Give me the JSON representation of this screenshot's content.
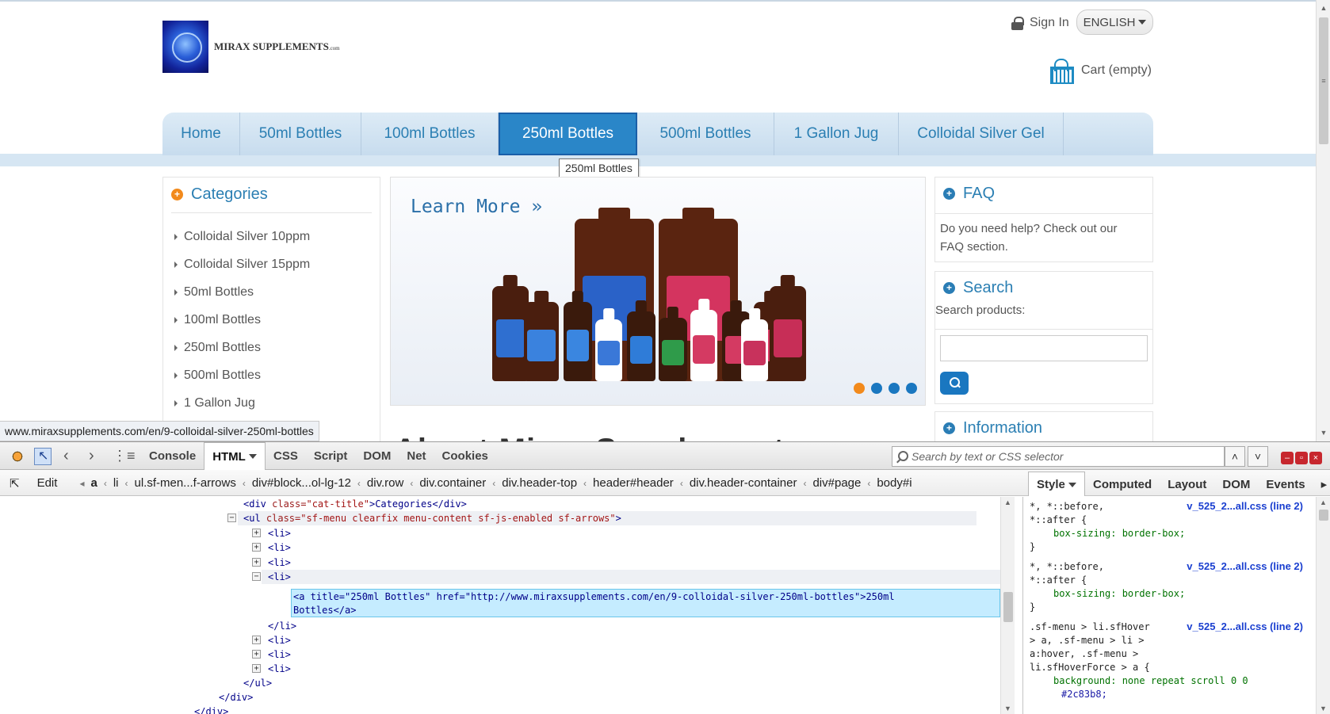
{
  "site": {
    "logo_text": "MIRAX SUPPLEMENTS",
    "logo_suffix": ".com",
    "sign_in": "Sign In",
    "language": "ENGLISH",
    "cart": "Cart (empty)",
    "nav": [
      {
        "label": "Home"
      },
      {
        "label": "50ml Bottles"
      },
      {
        "label": "100ml Bottles"
      },
      {
        "label": "250ml Bottles"
      },
      {
        "label": "500ml Bottles"
      },
      {
        "label": "1 Gallon Jug"
      },
      {
        "label": "Colloidal Silver Gel"
      }
    ],
    "tooltip": "250ml Bottles",
    "categories": {
      "title": "Categories",
      "items": [
        "Colloidal Silver 10ppm",
        "Colloidal Silver 15ppm",
        "50ml Bottles",
        "100ml Bottles",
        "250ml Bottles",
        "500ml Bottles",
        "1 Gallon Jug"
      ]
    },
    "banner": {
      "learn_more": "Learn More »"
    },
    "faq": {
      "title": "FAQ",
      "text": "Do you need help? Check out our FAQ section."
    },
    "search": {
      "title": "Search",
      "label": "Search products:",
      "value": ""
    },
    "information": {
      "title": "Information"
    },
    "about_heading": "About Mirax Supplements"
  },
  "status_url": "www.miraxsupplements.com/en/9-colloidal-silver-250ml-bottles",
  "firebug": {
    "tabs": [
      "Console",
      "HTML",
      "CSS",
      "Script",
      "DOM",
      "Net",
      "Cookies"
    ],
    "selected_tab": "HTML",
    "search_placeholder": "Search by text or CSS selector",
    "edit": "Edit",
    "breadcrumbs": [
      "a",
      "li",
      "ul.sf-men...f-arrows",
      "div#block...ol-lg-12",
      "div.row",
      "div.container",
      "div.header-top",
      "header#header",
      "div.header-container",
      "div#page",
      "body#i"
    ],
    "side_tabs": [
      "Style",
      "Computed",
      "Layout",
      "DOM",
      "Events"
    ],
    "html": {
      "l1_tag_open": "<div ",
      "l1_attr": "class=",
      "l1_val": "\"cat-title\"",
      "l1_text": ">Categories</div>",
      "ul_tag": "<ul ",
      "ul_attr": "class=",
      "ul_val": "\"sf-menu clearfix menu-content sf-js-enabled sf-arrows\"",
      "ul_close": ">",
      "li_open": "<li>",
      "a_line1": "<a title=\"250ml Bottles\" href=\"http://www.miraxsupplements.com/en/9-colloidal-silver-250ml-bottles\">250ml",
      "a_line2": "Bottles</a>",
      "li_close": "</li>",
      "ul_end": "</ul>",
      "div_end": "</div>",
      "div_end2": "</div>"
    },
    "style_rules": [
      {
        "selector1": "*, *::before,",
        "selector2": "*::after {",
        "source": "v_525_2...all.css (line 2)",
        "decl": "box-sizing: border-box;"
      },
      {
        "selector1": "*, *::before,",
        "selector2": "*::after {",
        "source": "v_525_2...all.css (line 2)",
        "decl": "box-sizing: border-box;"
      },
      {
        "selector1": ".sf-menu > li.sfHover",
        "selector2": "> a, .sf-menu > li >",
        "selector3": "a:hover, .sf-menu >",
        "selector4": "li.sfHoverForce > a {",
        "source": "v_525_2...all.css (line 2)",
        "decl": "background: none repeat scroll 0 0",
        "decl2": "#2c83b8;"
      }
    ]
  }
}
